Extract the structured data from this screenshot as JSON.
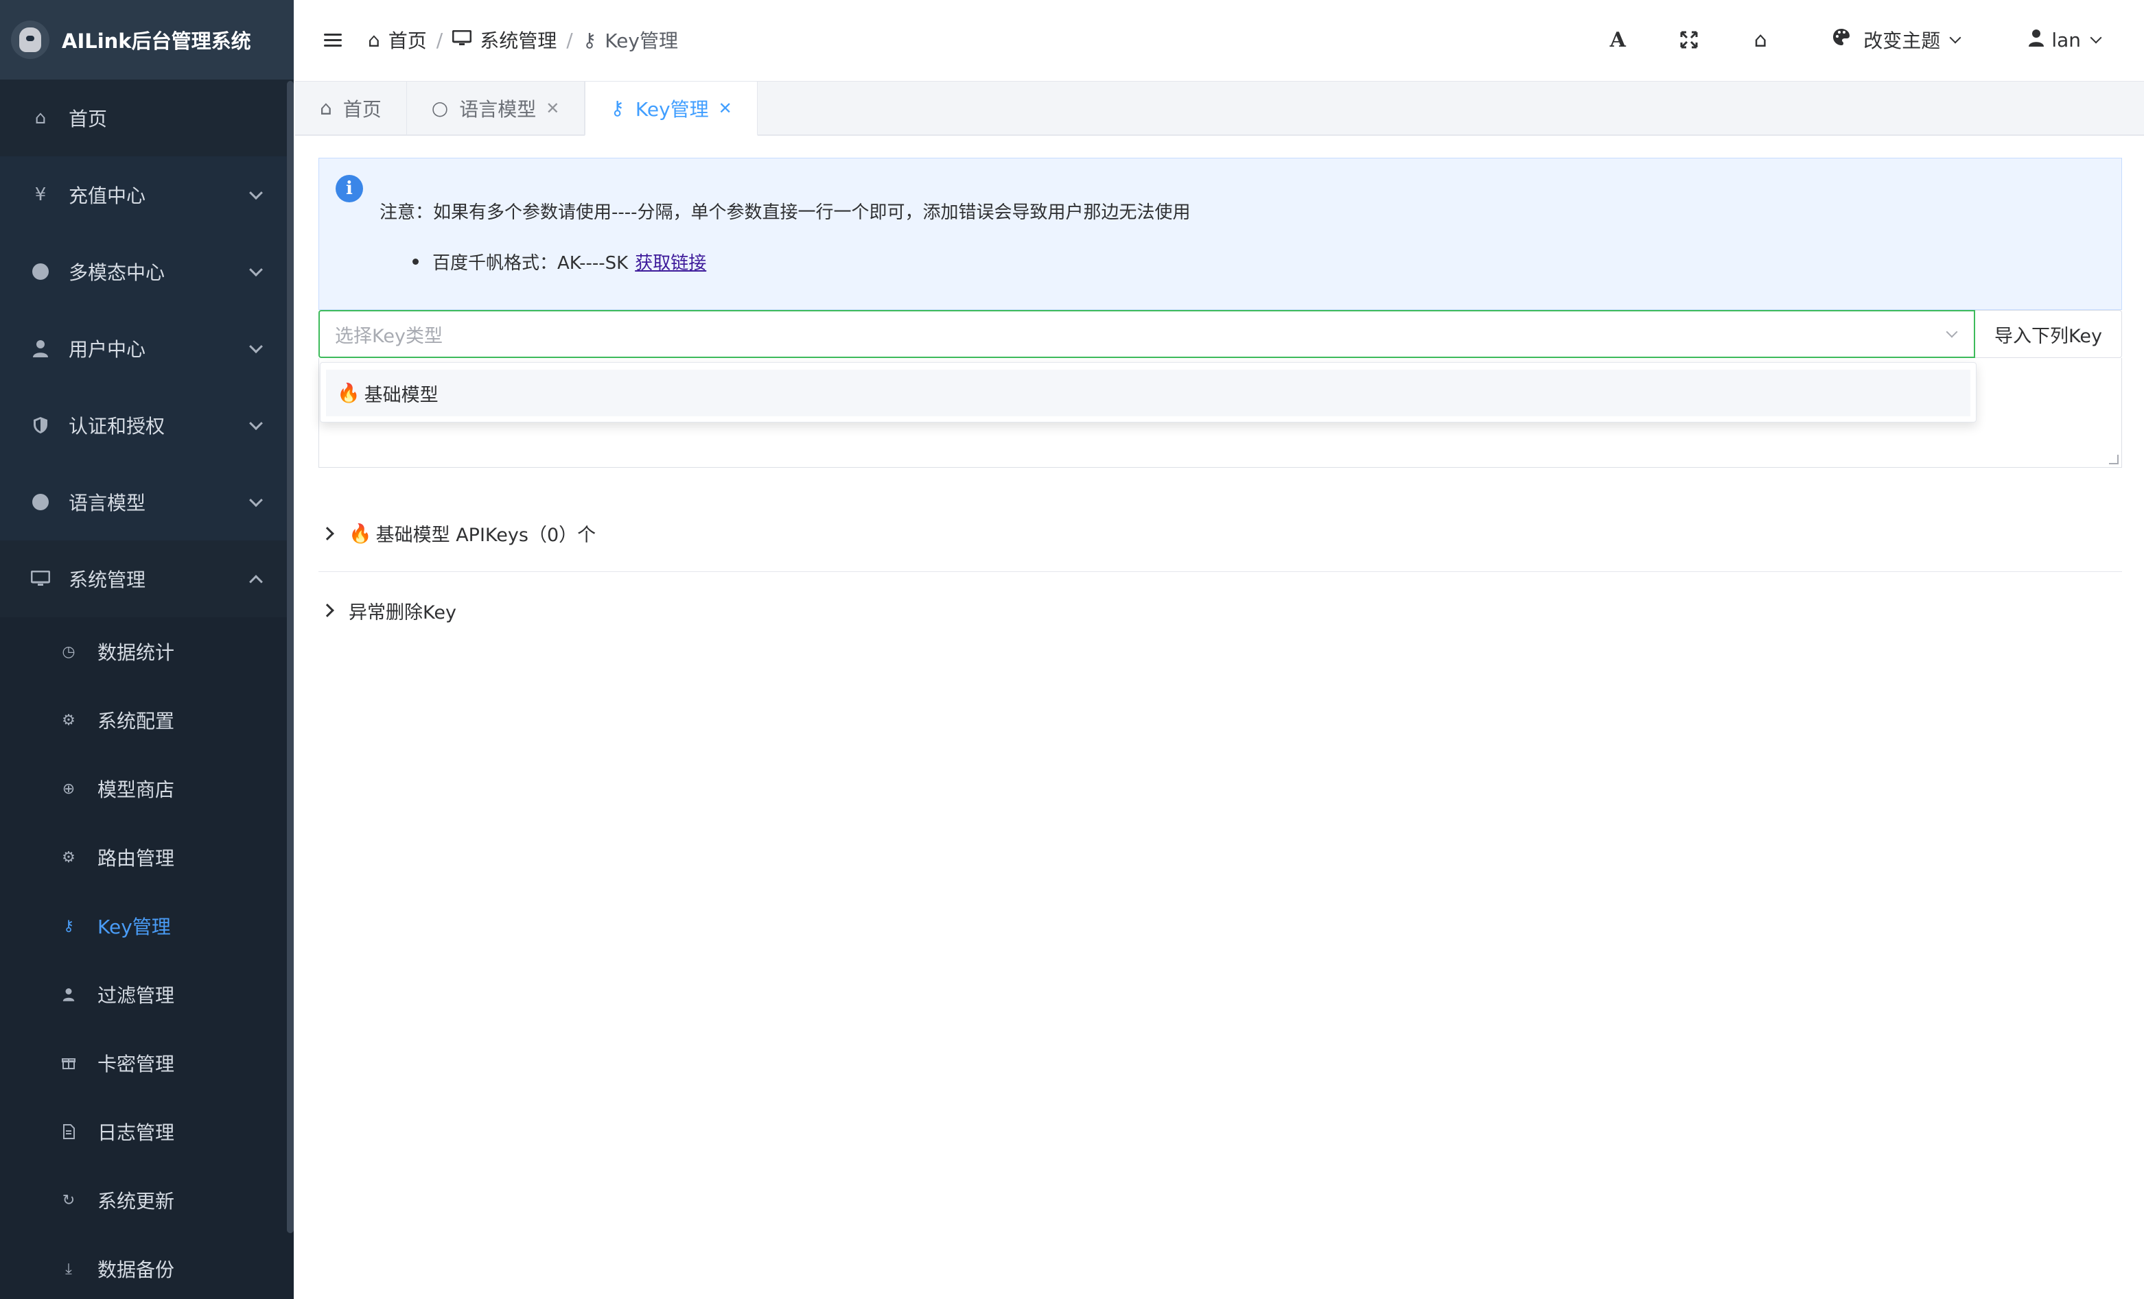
{
  "app": {
    "title": "AILink后台管理系统"
  },
  "sidebar": {
    "home": "首页",
    "groups": [
      {
        "label": "充值中心",
        "icon": "yen-icon"
      },
      {
        "label": "多模态中心",
        "icon": "dot-icon"
      },
      {
        "label": "用户中心",
        "icon": "user-icon"
      },
      {
        "label": "认证和授权",
        "icon": "shield-icon"
      },
      {
        "label": "语言模型",
        "icon": "dot-icon"
      },
      {
        "label": "系统管理",
        "icon": "monitor-icon"
      }
    ],
    "sub_items": [
      {
        "label": "数据统计",
        "icon": "pie-chart-icon"
      },
      {
        "label": "系统配置",
        "icon": "gear-icon"
      },
      {
        "label": "模型商店",
        "icon": "plus-circle-icon"
      },
      {
        "label": "路由管理",
        "icon": "gear-icon"
      },
      {
        "label": "Key管理",
        "icon": "key-icon"
      },
      {
        "label": "过滤管理",
        "icon": "user-icon"
      },
      {
        "label": "卡密管理",
        "icon": "gift-icon"
      },
      {
        "label": "日志管理",
        "icon": "document-icon"
      },
      {
        "label": "系统更新",
        "icon": "refresh-icon"
      },
      {
        "label": "数据备份",
        "icon": "download-icon"
      }
    ],
    "active_sub": "Key管理"
  },
  "header": {
    "breadcrumb": [
      "首页",
      "系统管理",
      "Key管理"
    ],
    "theme_label": "改变主题",
    "user_name": "lan"
  },
  "tabs": [
    {
      "label": "首页",
      "icon": "home-icon",
      "closable": false
    },
    {
      "label": "语言模型",
      "icon": "circle-icon",
      "closable": true
    },
    {
      "label": "Key管理",
      "icon": "key-icon",
      "closable": true,
      "active": true
    }
  ],
  "alert": {
    "note": "注意：如果有多个参数请使用----分隔，单个参数直接一行一个即可，添加错误会导致用户那边无法使用",
    "bullet_text": "百度千帆格式：AK----SK",
    "bullet_link": "获取链接"
  },
  "key_select": {
    "placeholder": "选择Key类型",
    "import_button": "导入下列Key",
    "options": [
      "基础模型"
    ]
  },
  "collapses": [
    {
      "label": "基础模型 APIKeys（0）个",
      "fire": true
    },
    {
      "label": "异常删除Key",
      "fire": false
    }
  ],
  "colors": {
    "sidebar_bg": "#1f2d3d",
    "accent": "#409eff",
    "focus_border": "#3dbb5b",
    "alert_bg": "#edf4ff"
  }
}
